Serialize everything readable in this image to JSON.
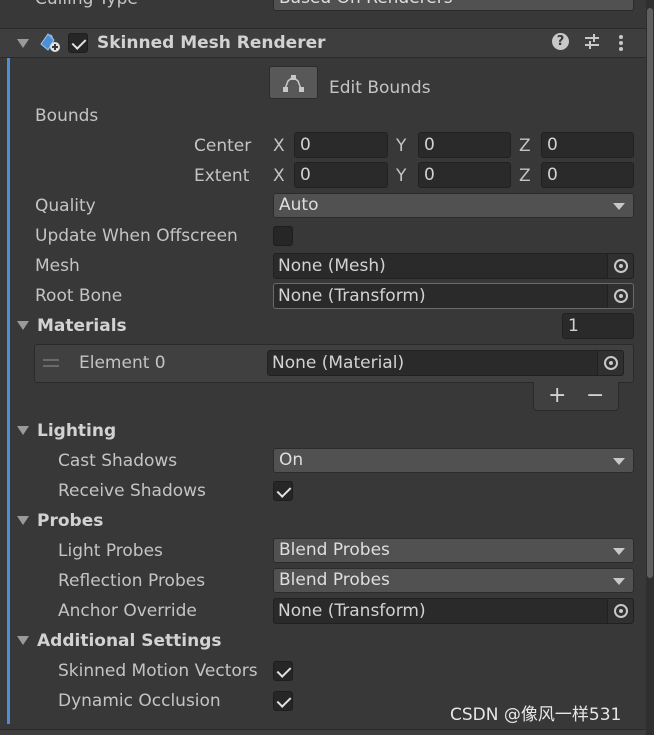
{
  "top_partial": {
    "label": "Culling Type",
    "value": "Based On Renderers"
  },
  "component": {
    "title": "Skinned Mesh Renderer",
    "enabled": true
  },
  "edit_bounds_label": "Edit Bounds",
  "bounds": {
    "label": "Bounds",
    "center": {
      "label": "Center",
      "x": "0",
      "y": "0",
      "z": "0"
    },
    "extent": {
      "label": "Extent",
      "x": "0",
      "y": "0",
      "z": "0"
    },
    "axis_x": "X",
    "axis_y": "Y",
    "axis_z": "Z"
  },
  "quality": {
    "label": "Quality",
    "value": "Auto"
  },
  "update_offscreen": {
    "label": "Update When Offscreen",
    "checked": false
  },
  "mesh": {
    "label": "Mesh",
    "value": "None (Mesh)"
  },
  "root_bone": {
    "label": "Root Bone",
    "value": "None (Transform)"
  },
  "materials": {
    "label": "Materials",
    "size": "1",
    "elements": [
      {
        "label": "Element 0",
        "value": "None (Material)"
      }
    ],
    "add": "+",
    "remove": "−"
  },
  "lighting": {
    "label": "Lighting",
    "cast_shadows": {
      "label": "Cast Shadows",
      "value": "On"
    },
    "receive_shadows": {
      "label": "Receive Shadows",
      "checked": true
    }
  },
  "probes": {
    "label": "Probes",
    "light_probes": {
      "label": "Light Probes",
      "value": "Blend Probes"
    },
    "reflection_probes": {
      "label": "Reflection Probes",
      "value": "Blend Probes"
    },
    "anchor_override": {
      "label": "Anchor Override",
      "value": "None (Transform)"
    }
  },
  "additional": {
    "label": "Additional Settings",
    "skinned_motion_vectors": {
      "label": "Skinned Motion Vectors",
      "checked": true
    },
    "dynamic_occlusion": {
      "label": "Dynamic Occlusion",
      "checked": true
    }
  },
  "watermark": "CSDN @像风一样531",
  "colors": {
    "background": "#383838",
    "header": "#3e3e3e",
    "field": "#2a2a2a",
    "accent": "#4d8fd6"
  }
}
